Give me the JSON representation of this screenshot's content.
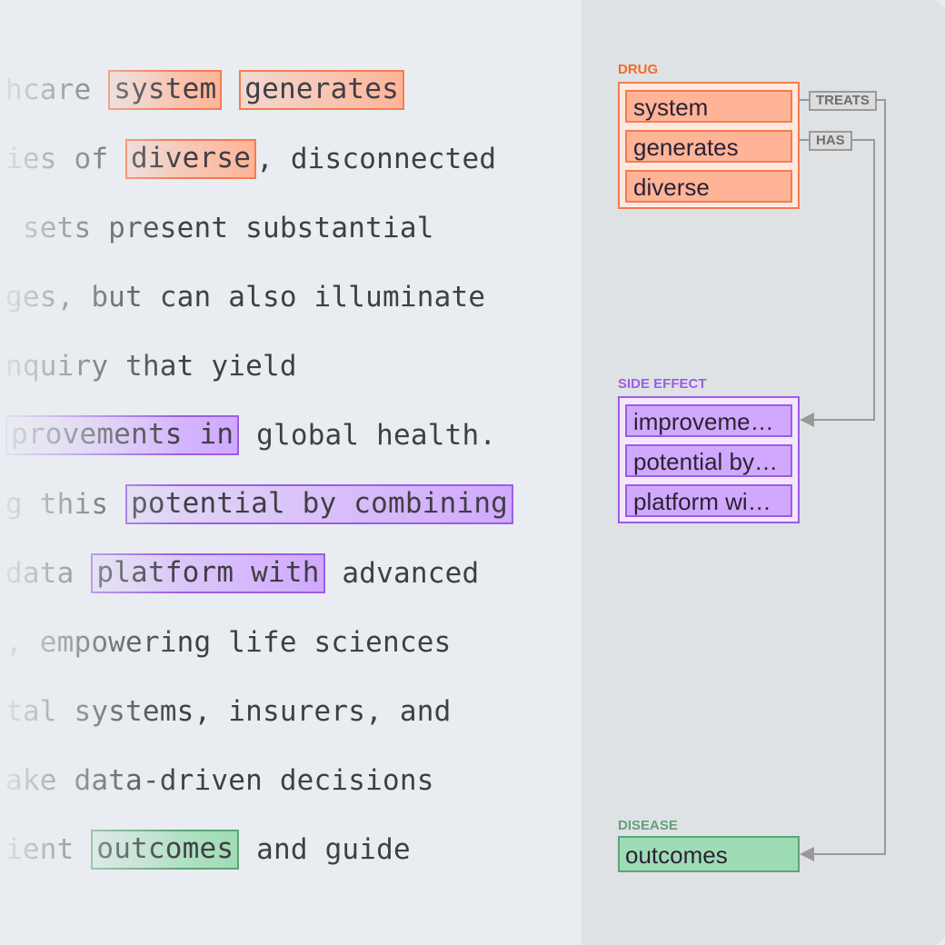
{
  "text_lines": [
    {
      "segments": [
        {
          "t": "hcare "
        },
        {
          "t": "system",
          "ent": "drug"
        },
        {
          "t": " "
        },
        {
          "t": "generates",
          "ent": "drug"
        }
      ]
    },
    {
      "segments": [
        {
          "t": "ies of "
        },
        {
          "t": "diverse",
          "ent": "drug"
        },
        {
          "t": ", disconnected"
        }
      ]
    },
    {
      "segments": [
        {
          "t": " sets present substantial"
        }
      ]
    },
    {
      "segments": [
        {
          "t": "ges, but can also illuminate"
        }
      ]
    },
    {
      "segments": [
        {
          "t": "nquiry that yield"
        }
      ]
    },
    {
      "segments": [
        {
          "t": "provements in",
          "ent": "side"
        },
        {
          "t": " global health."
        }
      ]
    },
    {
      "segments": [
        {
          "t": "g this "
        },
        {
          "t": "potential by combining",
          "ent": "side"
        }
      ]
    },
    {
      "segments": [
        {
          "t": "data "
        },
        {
          "t": "platform with",
          "ent": "side"
        },
        {
          "t": " advanced"
        }
      ]
    },
    {
      "segments": [
        {
          "t": ", empowering life sciences"
        }
      ]
    },
    {
      "segments": [
        {
          "t": "tal systems, insurers, and"
        }
      ]
    },
    {
      "segments": [
        {
          "t": "ake data-driven decisions"
        }
      ]
    },
    {
      "segments": [
        {
          "t": "ient "
        },
        {
          "t": "outcomes",
          "ent": "dis"
        },
        {
          "t": " and guide"
        }
      ]
    }
  ],
  "groups": {
    "drug": {
      "label": "DRUG",
      "color": "#f26b25",
      "entities": [
        "system",
        "generates",
        "diverse"
      ]
    },
    "side_effect": {
      "label": "SIDE EFFECT",
      "color": "#9b5de5",
      "entities": [
        "improveme…",
        "potential by…",
        "platform wi…"
      ]
    },
    "disease": {
      "label": "DISEASE",
      "color": "#5fa37a",
      "entities": [
        "outcomes"
      ]
    }
  },
  "relations": [
    {
      "label": "TREATS",
      "from": "DRUG",
      "to": "DISEASE"
    },
    {
      "label": "HAS",
      "from": "DRUG",
      "to": "SIDE EFFECT"
    }
  ]
}
